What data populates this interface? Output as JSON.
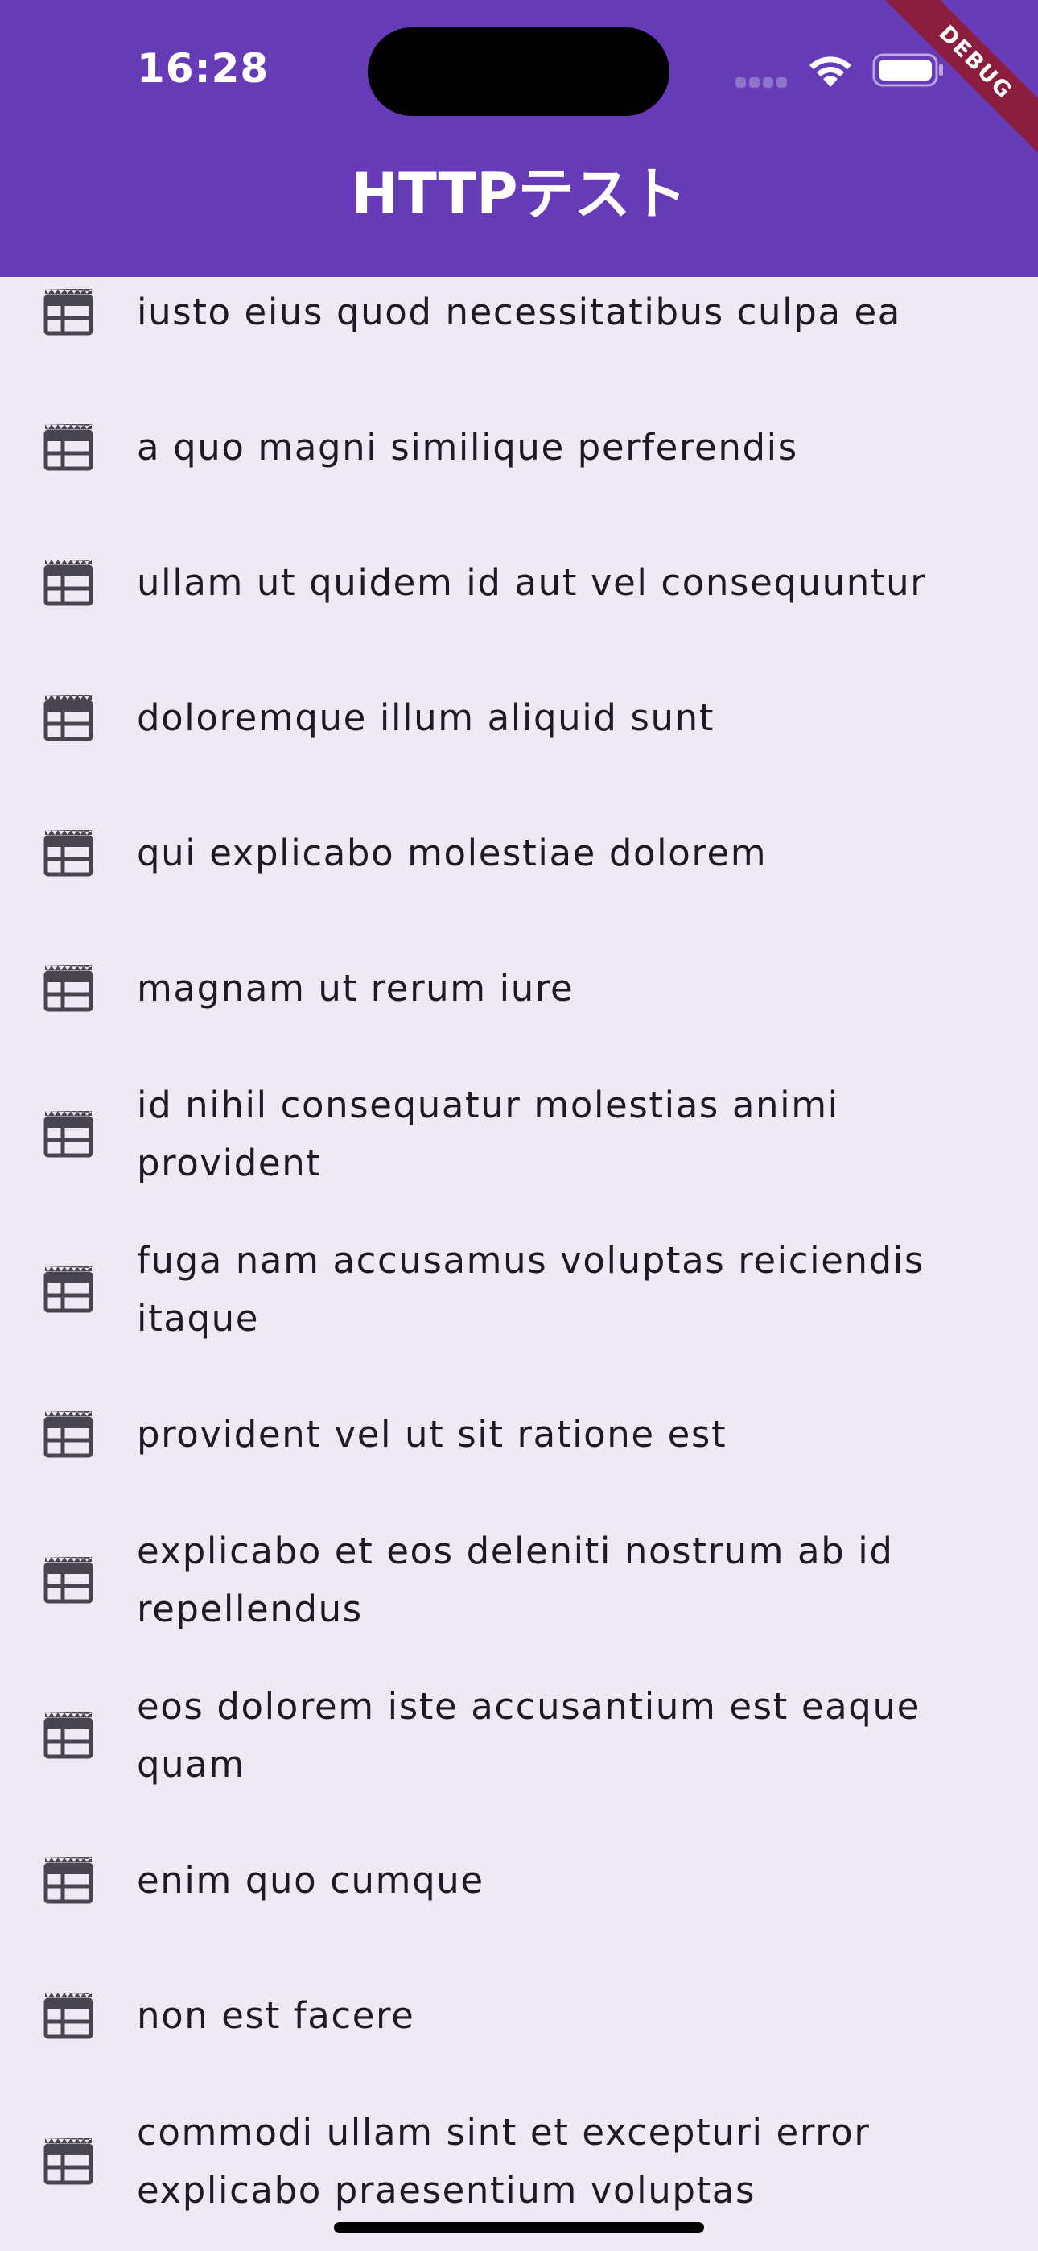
{
  "status_bar": {
    "time": "16:28"
  },
  "debug_banner": "DEBUG",
  "app_bar": {
    "title": "HTTPテスト",
    "background": "#673AB7"
  },
  "list": {
    "icon": "table-chart-icon",
    "items": [
      {
        "label": "iusto eius quod necessitatibus culpa ea",
        "lines": 1
      },
      {
        "label": "a quo magni similique perferendis",
        "lines": 1
      },
      {
        "label": "ullam ut quidem id aut vel consequuntur",
        "lines": 1
      },
      {
        "label": "doloremque illum aliquid sunt",
        "lines": 1
      },
      {
        "label": "qui explicabo molestiae dolorem",
        "lines": 1
      },
      {
        "label": "magnam ut rerum iure",
        "lines": 1
      },
      {
        "label": "id nihil consequatur molestias animi provident",
        "lines": 2
      },
      {
        "label": "fuga nam accusamus voluptas reiciendis itaque",
        "lines": 2
      },
      {
        "label": "provident vel ut sit ratione est",
        "lines": 1
      },
      {
        "label": "explicabo et eos deleniti nostrum ab id repellendus",
        "lines": 2
      },
      {
        "label": "eos dolorem iste accusantium est eaque quam",
        "lines": 2
      },
      {
        "label": "enim quo cumque",
        "lines": 1
      },
      {
        "label": "non est facere",
        "lines": 1
      },
      {
        "label": "commodi ullam sint et excepturi error explicabo praesentium voluptas",
        "lines": 2
      }
    ]
  }
}
